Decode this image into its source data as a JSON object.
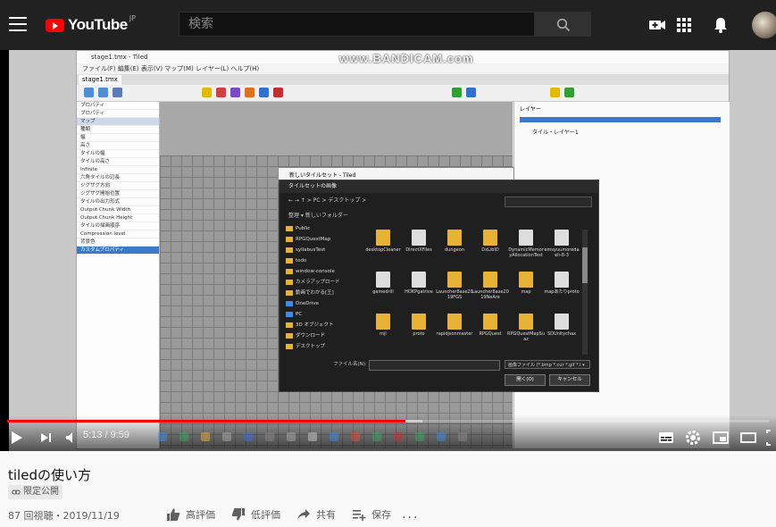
{
  "header": {
    "logo_text": "YouTube",
    "region": "JP",
    "search_placeholder": "検索"
  },
  "video": {
    "watermark": "www.BANDICAM.com",
    "current_time": "5:13",
    "duration": "9:59",
    "time_display": "5:13 / 9:59",
    "played_fraction": 0.523,
    "loaded_fraction": 0.545,
    "app": {
      "title": "stage1.tmx - Tiled",
      "menu": "ファイル(F)  編集(E)  表示(V)  マップ(M)  レイヤー(L)  ヘルプ(H)",
      "tab": "stage1.tmx",
      "property_rows": [
        "プロパティ",
        "プロパティ",
        "マップ",
        "種類",
        "幅",
        "高さ",
        "タイルの幅",
        "タイルの高さ",
        "Infinite",
        "六角タイルの辺長",
        "ジグザグ方向",
        "ジグザグ開始位置",
        "タイルの出力形式",
        "Output Chunk Width",
        "Output Chunk Height",
        "タイルの描画順序",
        "Compression level",
        "背景色",
        "カスタムプロパティ"
      ],
      "layer_panel_title": "レイヤー",
      "layer_name": "タイル・レイヤー1",
      "tileset_window_title": "新しいタイルセット - Tiled"
    },
    "dialog": {
      "title": "タイルセットの画像",
      "address": "← → ↑  > PC > デスクトップ >",
      "command_bar": "整理 ▾     新しいフォルダー",
      "nav_items": [
        {
          "label": "Public",
          "kind": "folder"
        },
        {
          "label": "RPGQuestMap",
          "kind": "folder"
        },
        {
          "label": "syllabusTest",
          "kind": "folder"
        },
        {
          "label": "todo",
          "kind": "folder"
        },
        {
          "label": "window-console",
          "kind": "folder"
        },
        {
          "label": "カメラアップロード",
          "kind": "folder"
        },
        {
          "label": "動画でわかる[王]",
          "kind": "folder"
        },
        {
          "label": "OneDrive",
          "kind": "cloud"
        },
        {
          "label": "PC",
          "kind": "pc"
        },
        {
          "label": "3D オブジェクト",
          "kind": "folder"
        },
        {
          "label": "ダウンロード",
          "kind": "folder"
        },
        {
          "label": "デスクトップ",
          "kind": "folder"
        }
      ],
      "files": [
        {
          "name": "desktopCleaner",
          "kind": "folder"
        },
        {
          "name": "DirectXFiles",
          "kind": "doc"
        },
        {
          "name": "dungeon",
          "kind": "folder"
        },
        {
          "name": "DxLibID",
          "kind": "folder"
        },
        {
          "name": "DynamicMemoryAllocationTest",
          "kind": "doc"
        },
        {
          "name": "emsyuumoredaeli-8-3",
          "kind": "doc"
        },
        {
          "name": "gamedrill",
          "kind": "doc"
        },
        {
          "name": "HOKPgatrive",
          "kind": "doc"
        },
        {
          "name": "Launcher8ase2019FGS",
          "kind": "folder"
        },
        {
          "name": "Launcher8ase2019NeAre",
          "kind": "folder"
        },
        {
          "name": "map",
          "kind": "folder"
        },
        {
          "name": "mapあたりproto",
          "kind": "doc"
        },
        {
          "name": "mji",
          "kind": "folder"
        },
        {
          "name": "proto",
          "kind": "folder"
        },
        {
          "name": "rapidjsonmaster",
          "kind": "folder"
        },
        {
          "name": "RPGQuest",
          "kind": "folder"
        },
        {
          "name": "RPGQuestMapSuaz",
          "kind": "folder"
        },
        {
          "name": "SDUnitychax",
          "kind": "doc"
        }
      ],
      "filename_label": "ファイル名(N):",
      "filetype": "画像ファイル (*.bmp *.cur *.gif *.i ▾",
      "open_label": "開く(O)",
      "cancel_label": "キャンセル"
    }
  },
  "info": {
    "title": "tiledの使い方",
    "privacy_badge": "限定公開",
    "views_date": "87 回視聴・2019/11/19",
    "like_label": "高評価",
    "dislike_label": "低評価",
    "share_label": "共有",
    "save_label": "保存",
    "more": "..."
  },
  "colors": {
    "header_bg": "#212121",
    "brand_red": "#ff0000",
    "progress_played": "#ff0000"
  }
}
